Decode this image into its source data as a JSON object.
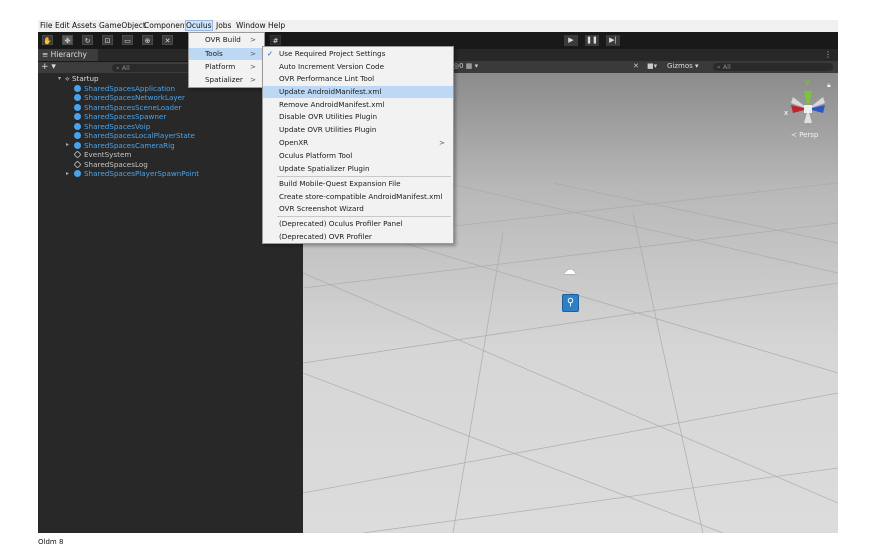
{
  "menubar": {
    "items": [
      "File",
      "Edit",
      "Assets",
      "GameObject",
      "Component",
      "Oculus",
      "Jobs",
      "Window",
      "Help"
    ]
  },
  "hierarchy": {
    "tab": "Hierarchy",
    "add": "+",
    "search_placeholder": "All",
    "scene": "Startup",
    "items": [
      {
        "label": "SharedSpacesApplication",
        "color": "blue"
      },
      {
        "label": "SharedSpacesNetworkLayer",
        "color": "blue"
      },
      {
        "label": "SharedSpacesSceneLoader",
        "color": "blue"
      },
      {
        "label": "SharedSpacesSpawner",
        "color": "blue"
      },
      {
        "label": "SharedSpacesVoip",
        "color": "blue"
      },
      {
        "label": "SharedSpacesLocalPlayerState",
        "color": "blue"
      },
      {
        "label": "SharedSpacesCameraRig",
        "color": "blue",
        "expandable": true
      },
      {
        "label": "EventSystem",
        "color": "grey"
      },
      {
        "label": "SharedSpacesLog",
        "color": "grey"
      },
      {
        "label": "SharedSpacesPlayerSpawnPoint",
        "color": "blue",
        "expandable": true
      }
    ]
  },
  "scene_view": {
    "gizmos_label": "Gizmos",
    "search_placeholder": "All",
    "persp_label": "Persp",
    "counter": "0",
    "axis_y": "y",
    "axis_x": "x"
  },
  "oculus_menu": {
    "items": [
      "OVR Build",
      "Tools",
      "Platform",
      "Spatializer"
    ]
  },
  "tools_menu": {
    "items": [
      {
        "label": "Use Required Project Settings",
        "checked": true
      },
      {
        "label": "Auto Increment Version Code"
      },
      {
        "label": "OVR Performance Lint Tool"
      },
      {
        "label": "Update AndroidManifest.xml",
        "highlight": true
      },
      {
        "label": "Remove AndroidManifest.xml"
      },
      {
        "label": "Disable OVR Utilities Plugin"
      },
      {
        "label": "Update OVR Utilities Plugin"
      },
      {
        "label": "OpenXR",
        "submenu": true
      },
      {
        "label": "Oculus Platform Tool"
      },
      {
        "label": "Update Spatializer Plugin"
      },
      {
        "label": "Build Mobile-Quest Expansion File"
      },
      {
        "label": "Create store-compatible AndroidManifest.xml"
      },
      {
        "label": "OVR Screenshot Wizard"
      },
      {
        "label": "(Deprecated) Oculus Profiler Panel"
      },
      {
        "label": "(Deprecated) OVR Profiler"
      }
    ]
  },
  "caption": "Oldm 8"
}
